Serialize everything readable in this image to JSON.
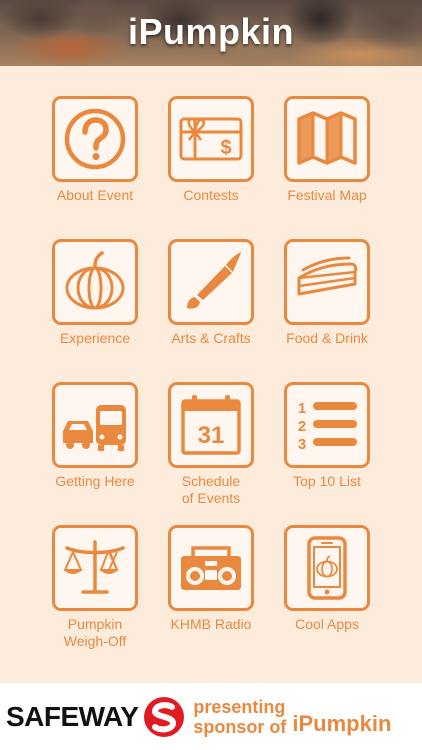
{
  "app_title": "iPumpkin",
  "colors": {
    "accent": "#e8893f",
    "background": "#fdebdc",
    "sponsor_red": "#e21b23"
  },
  "tiles": [
    {
      "label": "About Event",
      "icon": "question-mark-icon"
    },
    {
      "label": "Contests",
      "icon": "gift-card-icon"
    },
    {
      "label": "Festival Map",
      "icon": "folded-map-icon"
    },
    {
      "label": "Experience",
      "icon": "pumpkin-icon"
    },
    {
      "label": "Arts & Crafts",
      "icon": "paintbrush-icon"
    },
    {
      "label": "Food & Drink",
      "icon": "pie-slice-icon"
    },
    {
      "label": "Getting Here",
      "icon": "car-bus-icon"
    },
    {
      "label": "Schedule\nof Events",
      "icon": "calendar-icon"
    },
    {
      "label": "Top 10 List",
      "icon": "numbered-list-icon"
    },
    {
      "label": "Pumpkin\nWeigh-Off",
      "icon": "scale-icon"
    },
    {
      "label": "KHMB Radio",
      "icon": "boombox-icon"
    },
    {
      "label": "Cool Apps",
      "icon": "phone-icon"
    }
  ],
  "calendar_day": "31",
  "list_numbers": [
    "1",
    "2",
    "3"
  ],
  "footer": {
    "sponsor_name": "SAFEWAY",
    "presenting_line1": "presenting",
    "presenting_line2": "sponsor of",
    "app_name": "iPumpkin"
  }
}
